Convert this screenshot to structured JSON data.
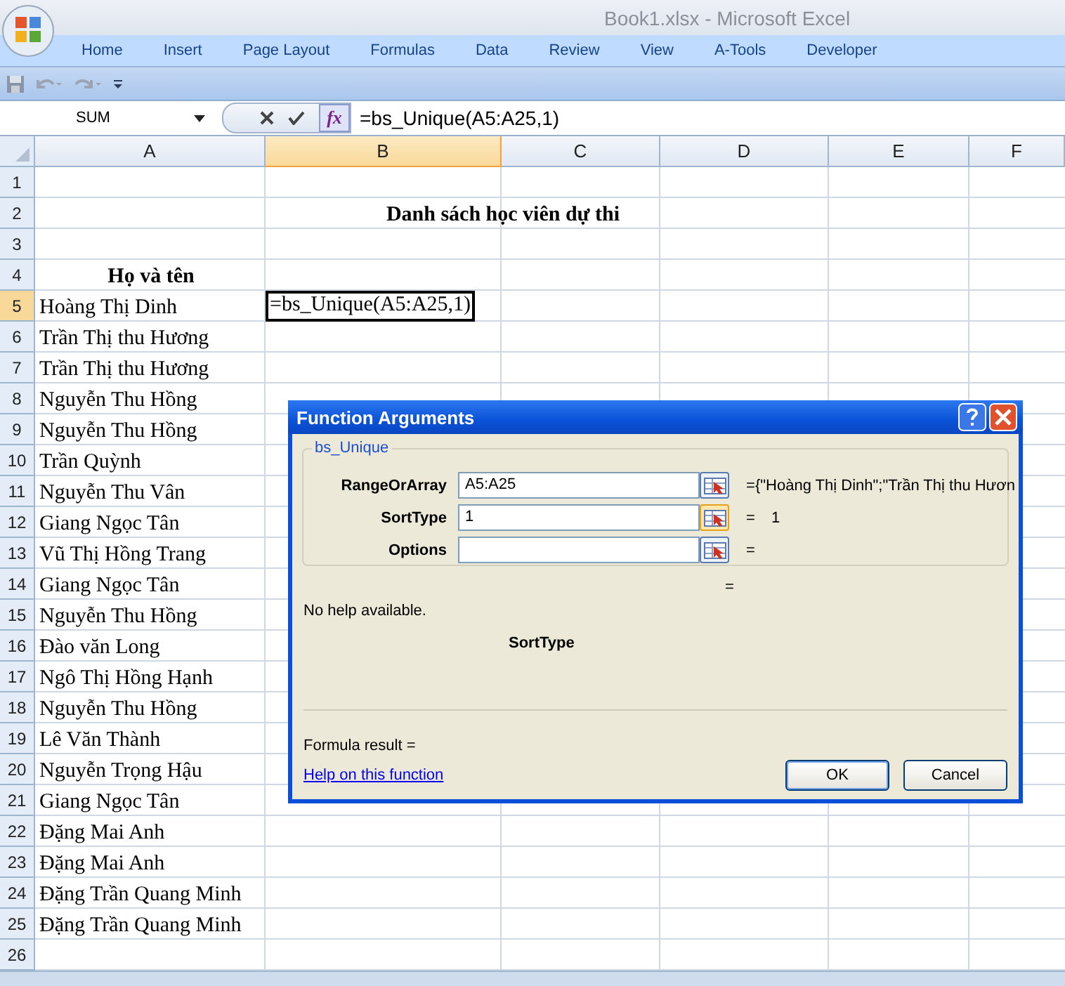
{
  "window": {
    "title": "Book1.xlsx - Microsoft Excel"
  },
  "ribbon_tabs": [
    {
      "label": "Home"
    },
    {
      "label": "Insert"
    },
    {
      "label": "Page Layout"
    },
    {
      "label": "Formulas"
    },
    {
      "label": "Data"
    },
    {
      "label": "Review"
    },
    {
      "label": "View"
    },
    {
      "label": "A-Tools"
    },
    {
      "label": "Developer"
    }
  ],
  "formula_bar": {
    "name_box": "SUM",
    "fx": "fx",
    "formula": "=bs_Unique(A5:A25,1)"
  },
  "columns": [
    {
      "label": "A",
      "selected": false
    },
    {
      "label": "B",
      "selected": true
    },
    {
      "label": "C",
      "selected": false
    },
    {
      "label": "D",
      "selected": false
    },
    {
      "label": "E",
      "selected": false
    },
    {
      "label": "F",
      "selected": false
    }
  ],
  "rows": [
    {
      "number": "1",
      "selected": false,
      "kind": "plain"
    },
    {
      "number": "2",
      "selected": false,
      "kind": "title",
      "text": "Danh sách học viên dự thi"
    },
    {
      "number": "3",
      "selected": false,
      "kind": "plain"
    },
    {
      "number": "4",
      "selected": false,
      "kind": "header",
      "text": "Họ và tên"
    },
    {
      "number": "5",
      "selected": true,
      "kind": "plain",
      "a": "Hoàng Thị Dinh",
      "b": "=bs_Unique(A5:A25,1)"
    },
    {
      "number": "6",
      "selected": false,
      "kind": "plain",
      "a": "Trần Thị thu Hương"
    },
    {
      "number": "7",
      "selected": false,
      "kind": "plain",
      "a": "Trần Thị thu Hương"
    },
    {
      "number": "8",
      "selected": false,
      "kind": "plain",
      "a": "Nguyễn Thu Hồng"
    },
    {
      "number": "9",
      "selected": false,
      "kind": "plain",
      "a": "Nguyễn Thu Hồng"
    },
    {
      "number": "10",
      "selected": false,
      "kind": "plain",
      "a": "Trần Quỳnh"
    },
    {
      "number": "11",
      "selected": false,
      "kind": "plain",
      "a": "Nguyễn Thu Vân"
    },
    {
      "number": "12",
      "selected": false,
      "kind": "plain",
      "a": "Giang Ngọc Tân"
    },
    {
      "number": "13",
      "selected": false,
      "kind": "plain",
      "a": "Vũ Thị Hồng Trang"
    },
    {
      "number": "14",
      "selected": false,
      "kind": "plain",
      "a": "Giang Ngọc Tân"
    },
    {
      "number": "15",
      "selected": false,
      "kind": "plain",
      "a": "Nguyễn Thu Hồng"
    },
    {
      "number": "16",
      "selected": false,
      "kind": "plain",
      "a": "Đào văn Long"
    },
    {
      "number": "17",
      "selected": false,
      "kind": "plain",
      "a": "Ngô Thị Hồng Hạnh"
    },
    {
      "number": "18",
      "selected": false,
      "kind": "plain",
      "a": "Nguyễn Thu Hồng"
    },
    {
      "number": "19",
      "selected": false,
      "kind": "plain",
      "a": "Lê Văn Thành"
    },
    {
      "number": "20",
      "selected": false,
      "kind": "plain",
      "a": "Nguyễn Trọng Hậu"
    },
    {
      "number": "21",
      "selected": false,
      "kind": "plain",
      "a": "Giang Ngọc Tân"
    },
    {
      "number": "22",
      "selected": false,
      "kind": "plain",
      "a": "Đặng Mai Anh"
    },
    {
      "number": "23",
      "selected": false,
      "kind": "plain",
      "a": "Đặng Mai Anh"
    },
    {
      "number": "24",
      "selected": false,
      "kind": "plain",
      "a": "Đặng Trần Quang Minh"
    },
    {
      "number": "25",
      "selected": false,
      "kind": "plain",
      "a": "Đặng Trần Quang Minh"
    },
    {
      "number": "26",
      "selected": false,
      "kind": "plain"
    }
  ],
  "dialog": {
    "title": "Function Arguments",
    "group": "bs_Unique",
    "arguments": [
      {
        "label": "RangeOrArray",
        "value": "A5:A25",
        "sign": "=",
        "result": "{\"Hoàng Thị Dinh\";\"Trần Thị thu Hươn",
        "focused": false
      },
      {
        "label": "SortType",
        "value": "1",
        "sign": "=",
        "result": "1",
        "focused": true
      },
      {
        "label": "Options",
        "sign": "=",
        "focused": false
      }
    ],
    "result_sign": "=",
    "help": "No help available.",
    "argument_name": "SortType",
    "formula_result": "Formula result =",
    "help_link": "Help on this function",
    "buttons": [
      {
        "label": "OK",
        "default": true
      },
      {
        "label": "Cancel",
        "default": false
      }
    ]
  }
}
